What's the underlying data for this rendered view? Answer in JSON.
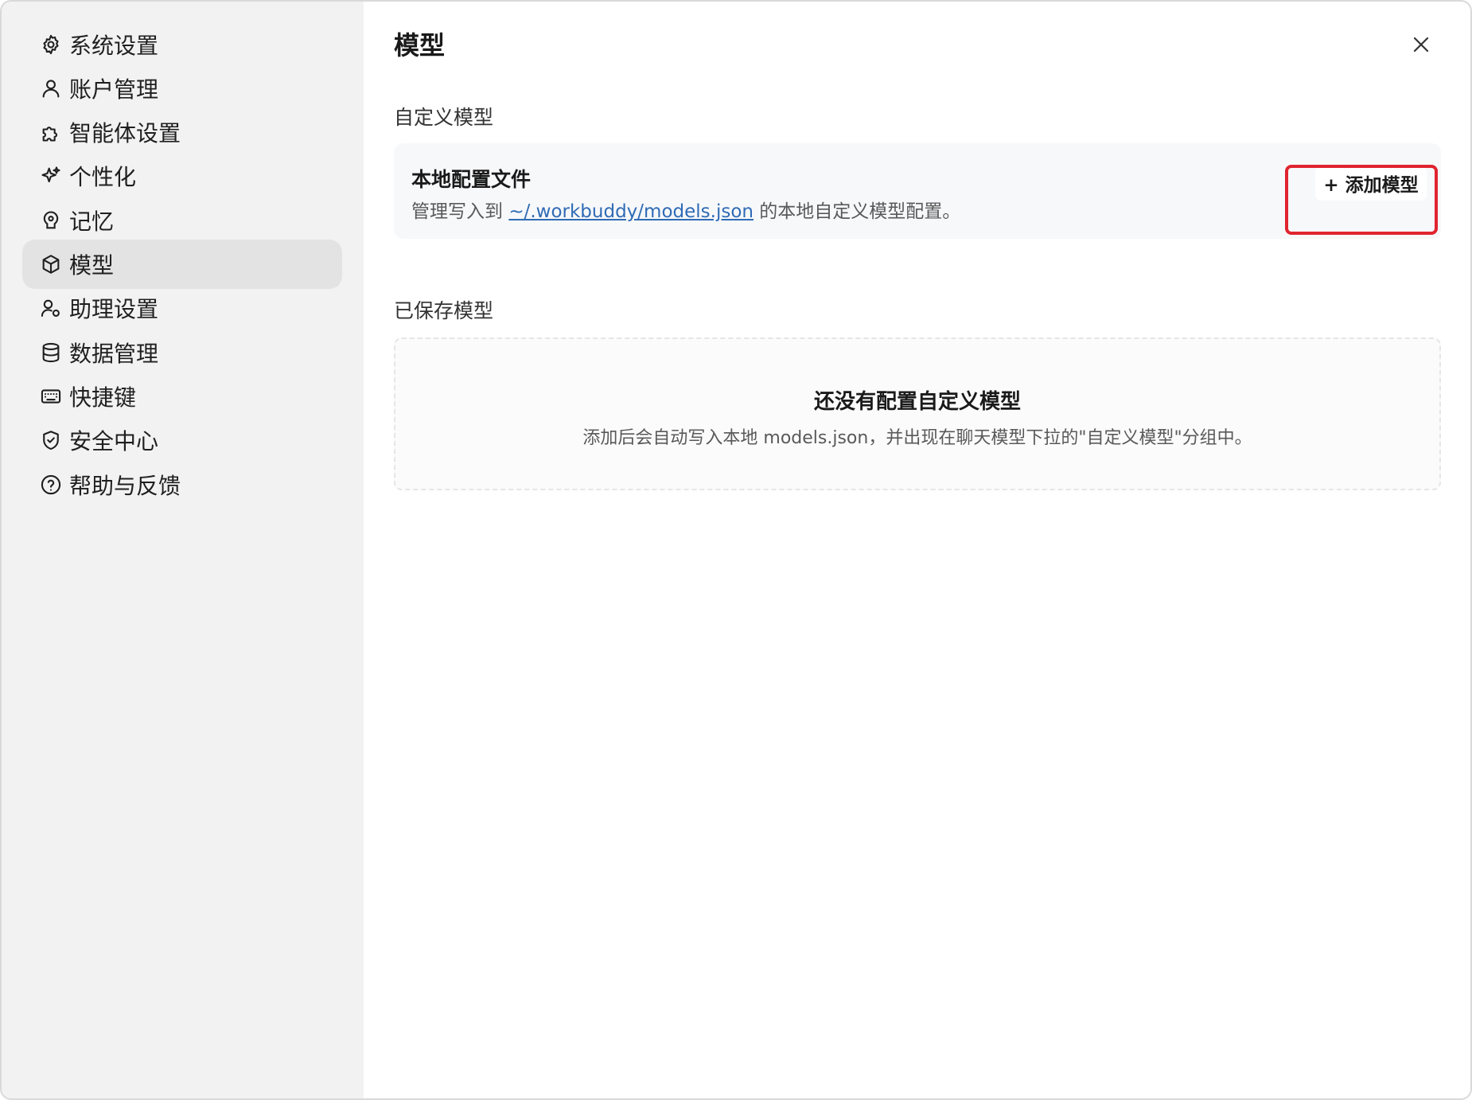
{
  "sidebar": {
    "items": [
      {
        "label": "系统设置",
        "icon": "gear-icon",
        "active": false
      },
      {
        "label": "账户管理",
        "icon": "user-icon",
        "active": false
      },
      {
        "label": "智能体设置",
        "icon": "puzzle-icon",
        "active": false
      },
      {
        "label": "个性化",
        "icon": "sparkles-icon",
        "active": false
      },
      {
        "label": "记忆",
        "icon": "memory-icon",
        "active": false
      },
      {
        "label": "模型",
        "icon": "cube-icon",
        "active": true
      },
      {
        "label": "助理设置",
        "icon": "assistant-icon",
        "active": false
      },
      {
        "label": "数据管理",
        "icon": "database-icon",
        "active": false
      },
      {
        "label": "快捷键",
        "icon": "keyboard-icon",
        "active": false
      },
      {
        "label": "安全中心",
        "icon": "shield-icon",
        "active": false
      },
      {
        "label": "帮助与反馈",
        "icon": "help-circle-icon",
        "active": false
      }
    ]
  },
  "main": {
    "title": "模型",
    "custom_section_label": "自定义模型",
    "local_config": {
      "title": "本地配置文件",
      "desc_prefix": "管理写入到 ",
      "path": "~/.workbuddy/models.json",
      "desc_suffix": " 的本地自定义模型配置。",
      "add_button": "+ 添加模型"
    },
    "saved_section_label": "已保存模型",
    "empty_state": {
      "title": "还没有配置自定义模型",
      "desc": "添加后会自动写入本地 models.json，并出现在聊天模型下拉的\"自定义模型\"分组中。"
    }
  },
  "colors": {
    "sidebar_bg": "#f2f2f2",
    "active_item_bg": "#e3e3e3",
    "link": "#2f6bb5",
    "highlight": "#e0242f"
  }
}
